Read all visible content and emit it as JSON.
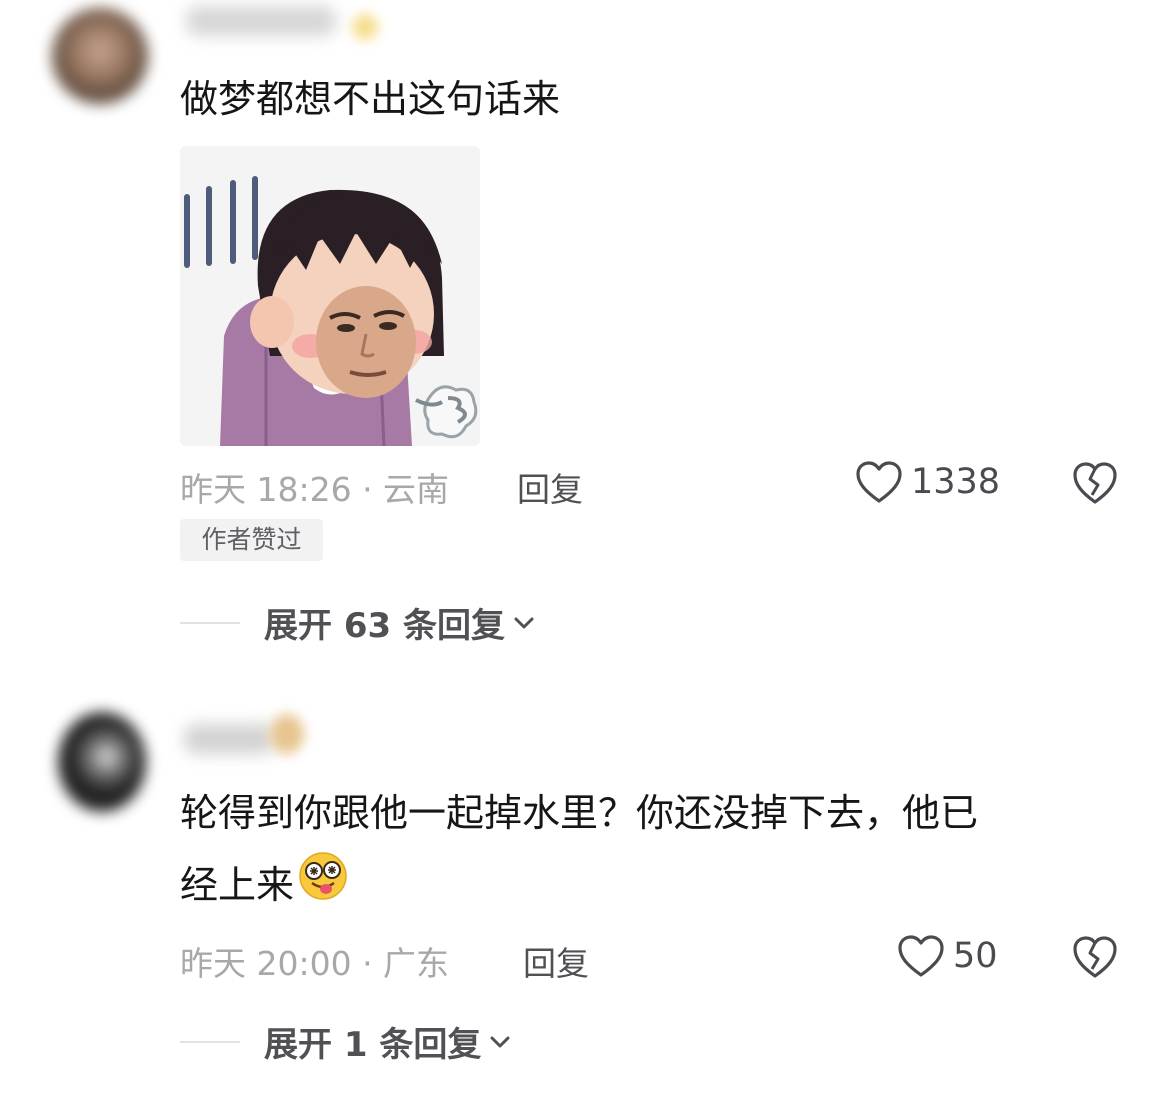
{
  "comments": [
    {
      "text": "做梦都想不出这句话来",
      "time_location": "昨天 18:26 · 云南",
      "reply_label": "回复",
      "likes": "1338",
      "badge": "作者赞过",
      "expand_label": "展开 63 条回复"
    },
    {
      "text_line1": "轮得到你跟他一起掉水里？你还没掉下去，他已",
      "text_line2": "经上来",
      "time_location": "昨天 20:00 · 广东",
      "reply_label": "回复",
      "likes": "50",
      "expand_label": "展开 1 条回复"
    }
  ],
  "icons": {
    "like": "heart-outline-icon",
    "dislike": "broken-heart-icon",
    "expand": "chevron-down-icon",
    "emoji": "dizzy-tongue-face-emoji"
  },
  "colors": {
    "text_primary": "#161616",
    "text_meta": "#a8a8ab",
    "text_secondary": "#505055",
    "badge_bg": "#f2f2f3"
  }
}
